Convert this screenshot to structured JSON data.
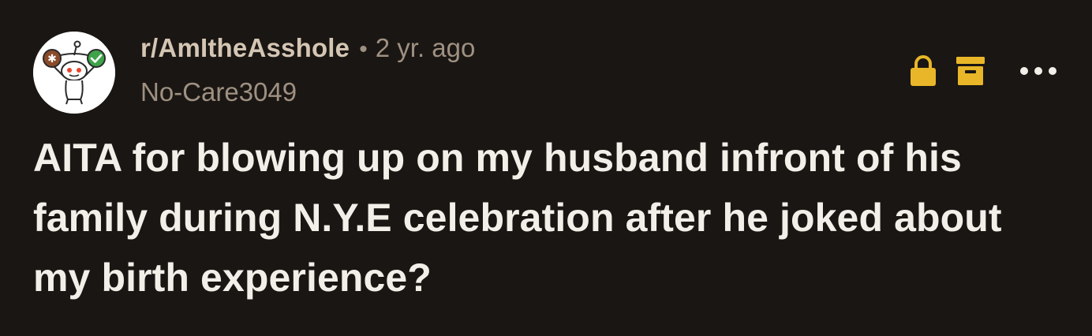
{
  "post": {
    "subreddit": "r/AmItheAsshole",
    "separator": "•",
    "age": "2 yr. ago",
    "username": "No-Care3049",
    "title": "AITA for blowing up on my husband infront of his family during N.Y.E celebration after he joked about my birth experience?"
  },
  "icons": {
    "avatar": "snoo-scales-avatar",
    "lock": "lock-icon",
    "archive": "archive-icon",
    "more": "more-options-icon"
  },
  "colors": {
    "background": "#1a1613",
    "mod_icons": "#e8b628",
    "subreddit": "#d4c6b3",
    "meta": "#9f9182",
    "title": "#f2efe9"
  }
}
